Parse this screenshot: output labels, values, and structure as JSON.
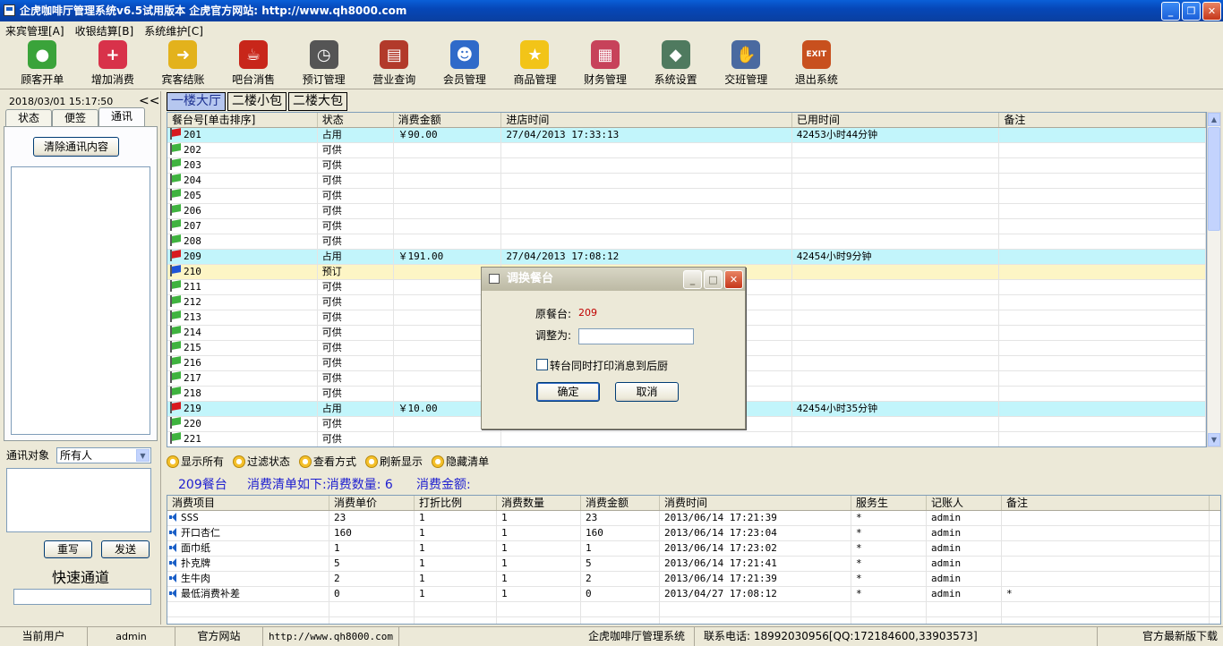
{
  "window": {
    "title": "企虎咖啡厅管理系统v6.5试用版本   企虎官方网站: http://www.qh8000.com"
  },
  "menu": [
    "来宾管理[A]",
    "收银结算[B]",
    "系统维护[C]"
  ],
  "toolbar": [
    {
      "label": "顾客开单",
      "icon": "customer-open-icon",
      "color": "#3aa33a",
      "glyph": "●"
    },
    {
      "label": "增加消费",
      "icon": "add-consumption-icon",
      "color": "#d8324a",
      "glyph": "+"
    },
    {
      "label": "宾客结账",
      "icon": "checkout-icon",
      "color": "#e3b21c",
      "glyph": "➜"
    },
    {
      "label": "吧台消售",
      "icon": "bar-sales-icon",
      "color": "#c8261a",
      "glyph": "☕"
    },
    {
      "label": "预订管理",
      "icon": "alarm-clock-icon",
      "color": "#555555",
      "glyph": "◷"
    },
    {
      "label": "营业查询",
      "icon": "business-query-icon",
      "color": "#b23a2a",
      "glyph": "▤"
    },
    {
      "label": "会员管理",
      "icon": "members-icon",
      "color": "#2f6ac9",
      "glyph": "☻"
    },
    {
      "label": "商品管理",
      "icon": "star-icon",
      "color": "#f2c418",
      "glyph": "★"
    },
    {
      "label": "财务管理",
      "icon": "finance-icon",
      "color": "#c7425a",
      "glyph": "▦"
    },
    {
      "label": "系统设置",
      "icon": "settings-icon",
      "color": "#4f7a5f",
      "glyph": "◆"
    },
    {
      "label": "交班管理",
      "icon": "handshake-icon",
      "color": "#4a6aa0",
      "glyph": "✋"
    },
    {
      "label": "退出系统",
      "icon": "exit-icon",
      "color": "#c8501e",
      "glyph": "EXIT"
    }
  ],
  "left": {
    "datetime": "2018/03/01  15:17:50",
    "collapse": "<<",
    "tabs": [
      "状态",
      "便签",
      "通讯"
    ],
    "clear_btn": "清除通讯内容",
    "target_label": "通讯对象",
    "target_value": "所有人",
    "rewrite_btn": "重写",
    "send_btn": "发送",
    "quick_label": "快速通道"
  },
  "hall_tabs": [
    "一楼大厅",
    "二楼小包",
    "二楼大包"
  ],
  "tables": {
    "headers": [
      "餐台号[单击排序]",
      "状态",
      "消费金额",
      "进店时间",
      "已用时间",
      "备注"
    ],
    "rows": [
      {
        "no": "201",
        "status": "占用",
        "amount": "￥90.00",
        "time": "27/04/2013 17:33:13",
        "used": "42453小时44分钟",
        "note": "",
        "state": "occ"
      },
      {
        "no": "202",
        "status": "可供",
        "amount": "",
        "time": "",
        "used": "",
        "note": "",
        "state": "free"
      },
      {
        "no": "203",
        "status": "可供",
        "amount": "",
        "time": "",
        "used": "",
        "note": "",
        "state": "free"
      },
      {
        "no": "204",
        "status": "可供",
        "amount": "",
        "time": "",
        "used": "",
        "note": "",
        "state": "free"
      },
      {
        "no": "205",
        "status": "可供",
        "amount": "",
        "time": "",
        "used": "",
        "note": "",
        "state": "free"
      },
      {
        "no": "206",
        "status": "可供",
        "amount": "",
        "time": "",
        "used": "",
        "note": "",
        "state": "free"
      },
      {
        "no": "207",
        "status": "可供",
        "amount": "",
        "time": "",
        "used": "",
        "note": "",
        "state": "free"
      },
      {
        "no": "208",
        "status": "可供",
        "amount": "",
        "time": "",
        "used": "",
        "note": "",
        "state": "free"
      },
      {
        "no": "209",
        "status": "占用",
        "amount": "￥191.00",
        "time": "27/04/2013 17:08:12",
        "used": "42454小时9分钟",
        "note": "",
        "state": "occ"
      },
      {
        "no": "210",
        "status": "预订",
        "amount": "",
        "time": "",
        "used": "",
        "note": "",
        "state": "res"
      },
      {
        "no": "211",
        "status": "可供",
        "amount": "",
        "time": "",
        "used": "",
        "note": "",
        "state": "free"
      },
      {
        "no": "212",
        "status": "可供",
        "amount": "",
        "time": "",
        "used": "",
        "note": "",
        "state": "free"
      },
      {
        "no": "213",
        "status": "可供",
        "amount": "",
        "time": "",
        "used": "",
        "note": "",
        "state": "free"
      },
      {
        "no": "214",
        "status": "可供",
        "amount": "",
        "time": "",
        "used": "",
        "note": "",
        "state": "free"
      },
      {
        "no": "215",
        "status": "可供",
        "amount": "",
        "time": "",
        "used": "",
        "note": "",
        "state": "free"
      },
      {
        "no": "216",
        "status": "可供",
        "amount": "",
        "time": "",
        "used": "",
        "note": "",
        "state": "free"
      },
      {
        "no": "217",
        "status": "可供",
        "amount": "",
        "time": "",
        "used": "",
        "note": "",
        "state": "free"
      },
      {
        "no": "218",
        "status": "可供",
        "amount": "",
        "time": "",
        "used": "",
        "note": "",
        "state": "free"
      },
      {
        "no": "219",
        "status": "占用",
        "amount": "￥10.00",
        "time": "",
        "used": "42454小时35分钟",
        "note": "",
        "state": "occ"
      },
      {
        "no": "220",
        "status": "可供",
        "amount": "",
        "time": "",
        "used": "",
        "note": "",
        "state": "free"
      },
      {
        "no": "221",
        "status": "可供",
        "amount": "",
        "time": "",
        "used": "",
        "note": "",
        "state": "free"
      }
    ]
  },
  "links": [
    "显示所有",
    "过滤状态",
    "查看方式",
    "刷新显示",
    "隐藏清单"
  ],
  "summary": {
    "table": "209餐台",
    "list": "消费清单如下:消费数量: 6",
    "amount": "消费金额:"
  },
  "consumption": {
    "headers": [
      "消费项目",
      "消费单价",
      "打折比例",
      "消费数量",
      "消费金额",
      "消费时间",
      "服务生",
      "记账人",
      "备注"
    ],
    "rows": [
      [
        "SSS",
        "23",
        "1",
        "1",
        "23",
        "2013/06/14 17:21:39",
        "*",
        "admin",
        ""
      ],
      [
        "开口杏仁",
        "160",
        "1",
        "1",
        "160",
        "2013/06/14 17:23:04",
        "*",
        "admin",
        ""
      ],
      [
        "面巾纸",
        "1",
        "1",
        "1",
        "1",
        "2013/06/14 17:23:02",
        "*",
        "admin",
        ""
      ],
      [
        "扑克牌",
        "5",
        "1",
        "1",
        "5",
        "2013/06/14 17:21:41",
        "*",
        "admin",
        ""
      ],
      [
        "生牛肉",
        "2",
        "1",
        "1",
        "2",
        "2013/06/14 17:21:39",
        "*",
        "admin",
        ""
      ],
      [
        "最低消费补差",
        "0",
        "1",
        "1",
        "0",
        "2013/04/27 17:08:12",
        "*",
        "admin",
        "*"
      ]
    ]
  },
  "status": [
    "当前用户",
    "admin",
    "官方网站",
    "http://www.qh8000.com",
    "企虎咖啡厅管理系统",
    "联系电话: 18992030956[QQ:172184600,33903573]",
    "官方最新版下载"
  ],
  "dialog": {
    "title": "调换餐台",
    "orig_label": "原餐台:",
    "orig_value": "209",
    "adjust_label": "调整为:",
    "checkbox_label": "转台同时打印消息到后厨",
    "ok": "确定",
    "cancel": "取消"
  },
  "colors": {
    "occupied_row": "#c2f5fb",
    "reserved_row": "#fdf5c5",
    "flag_free": "#3fb33f",
    "flag_occ": "#d8191e",
    "flag_res": "#1f54d8",
    "orig_value": "#c00000"
  }
}
